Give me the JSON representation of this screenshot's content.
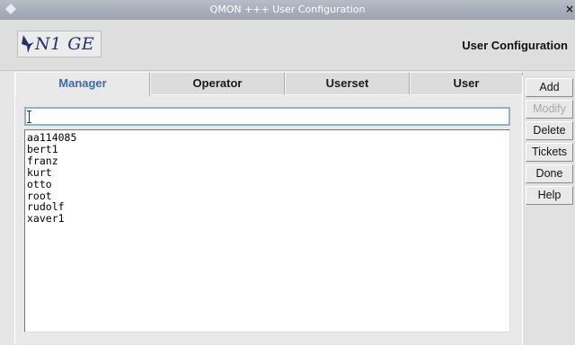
{
  "window": {
    "title": "QMON +++ User Configuration"
  },
  "header": {
    "logo_text": "N1 GE",
    "title": "User Configuration"
  },
  "tabs": [
    {
      "label": "Manager",
      "active": true
    },
    {
      "label": "Operator",
      "active": false
    },
    {
      "label": "Userset",
      "active": false
    },
    {
      "label": "User",
      "active": false
    }
  ],
  "input": {
    "value": ""
  },
  "users": [
    "aa114085",
    "bert1",
    "franz",
    "kurt",
    "otto",
    "root",
    "rudolf",
    "xaver1"
  ],
  "buttons": {
    "add": "Add",
    "modify": "Modify",
    "delete": "Delete",
    "tickets": "Tickets",
    "done": "Done",
    "help": "Help"
  },
  "colors": {
    "active_tab": "#3b6ba4",
    "input_border": "#8fb3c7",
    "titlebar": "#a4a9b4"
  }
}
